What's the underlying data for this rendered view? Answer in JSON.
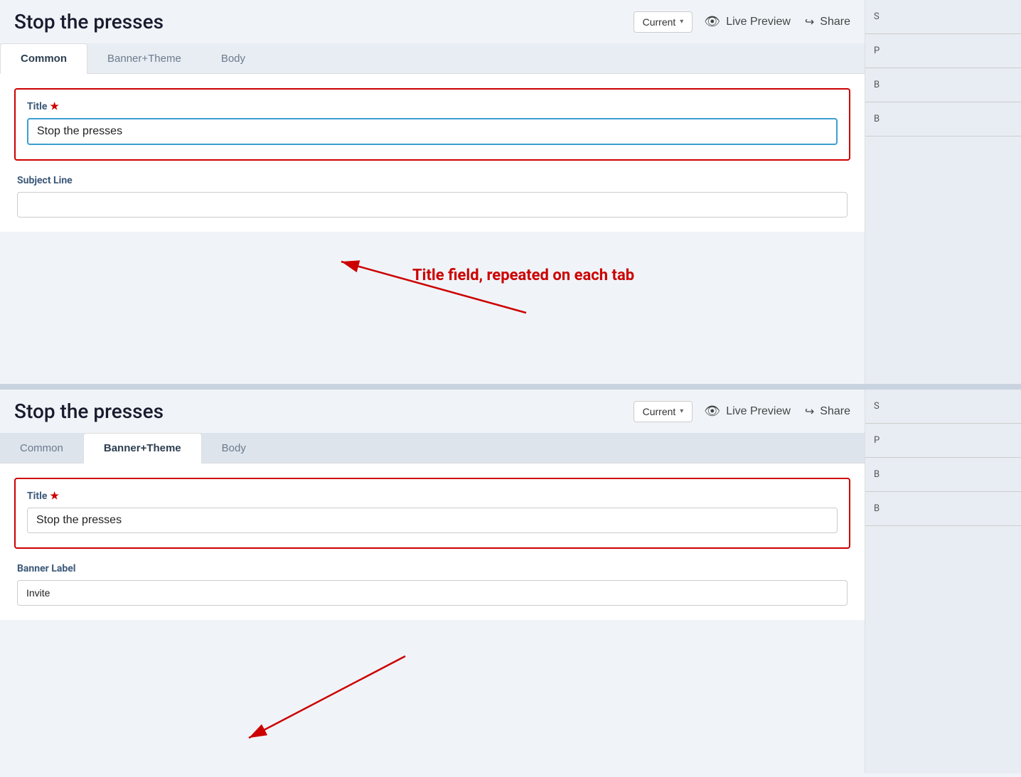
{
  "header1": {
    "title": "Stop the presses",
    "version_label": "Current",
    "live_preview_label": "Live Preview",
    "share_label": "Share"
  },
  "header2": {
    "title": "Stop the presses",
    "version_label": "Current",
    "live_preview_label": "Live Preview",
    "share_label": "Share"
  },
  "tabs1": {
    "common": "Common",
    "banner_theme": "Banner+Theme",
    "body": "Body"
  },
  "tabs2": {
    "common": "Common",
    "banner_theme": "Banner+Theme",
    "body": "Body"
  },
  "panel1": {
    "title_label": "Title",
    "title_value": "Stop the presses",
    "subject_label": "Subject Line",
    "subject_placeholder": ""
  },
  "panel2": {
    "title_label": "Title",
    "title_value": "Stop the presses",
    "banner_label": "Banner Label",
    "banner_value": "Invite"
  },
  "annotation": {
    "text": "Title field, repeated on each tab"
  },
  "right_panel1": {
    "items": [
      "S",
      "P",
      "B",
      "B"
    ]
  },
  "right_panel2": {
    "items": [
      "S",
      "P",
      "B",
      "B"
    ]
  }
}
